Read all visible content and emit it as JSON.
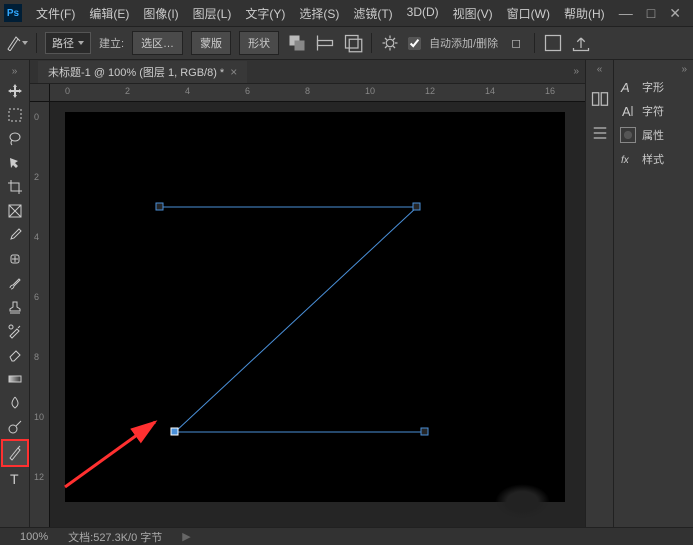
{
  "menu": {
    "file": "文件(F)",
    "edit": "编辑(E)",
    "image": "图像(I)",
    "layer": "图层(L)",
    "type": "文字(Y)",
    "select": "选择(S)",
    "filter": "滤镜(T)",
    "threed": "3D(D)",
    "view": "视图(V)",
    "window": "窗口(W)",
    "help": "帮助(H)"
  },
  "options": {
    "mode_label": "路径",
    "establish": "建立:",
    "selection": "选区…",
    "mask": "蒙版",
    "shape": "形状",
    "auto_add": "自动添加/删除"
  },
  "tab": {
    "title": "未标题-1 @ 100% (图层 1, RGB/8) *"
  },
  "ruler_h": [
    "0",
    "2",
    "4",
    "6",
    "8",
    "10",
    "12",
    "14",
    "16"
  ],
  "ruler_v": [
    "0",
    "2",
    "4",
    "6",
    "8",
    "10",
    "12"
  ],
  "chart_data": {
    "type": "path",
    "description": "Z-shaped pen path on black canvas",
    "anchors": [
      {
        "x": 1.9,
        "y": 2.7,
        "state": "hollow"
      },
      {
        "x": 11.1,
        "y": 2.7,
        "state": "hollow"
      },
      {
        "x": 2.4,
        "y": 11.1,
        "state": "selected"
      },
      {
        "x": 11.4,
        "y": 11.1,
        "state": "hollow"
      }
    ],
    "segments": [
      [
        0,
        1
      ],
      [
        1,
        2
      ],
      [
        2,
        3
      ]
    ]
  },
  "panels": {
    "glyphs": "字形",
    "character": "字符",
    "properties": "属性",
    "styles": "样式"
  },
  "status": {
    "zoom": "100%",
    "doc_info": "文档:527.3K/0 字节"
  }
}
